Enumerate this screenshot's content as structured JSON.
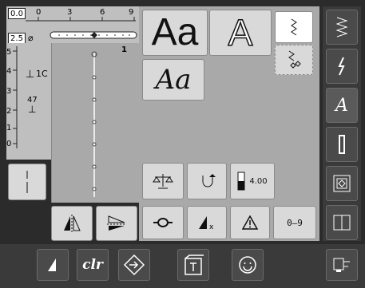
{
  "colors": {
    "background": "#2b2b2b",
    "lcd": "#bfbfbf",
    "panel": "#a9a9a9",
    "button": "#d9d9d9",
    "button_selected": "#ffffff",
    "dark_button": "#4a4a4a"
  },
  "top_ruler": {
    "value_box": "0.0",
    "ticks": [
      "0",
      "3",
      "6",
      "9"
    ]
  },
  "left_ruler": {
    "value_box": "2.5",
    "ticks": [
      "5",
      "4",
      "3",
      "2",
      "1",
      "0"
    ]
  },
  "stitch_info": {
    "presser_foot": "1C",
    "needle_label": "47"
  },
  "pattern": {
    "counter": "1"
  },
  "fonts": {
    "block_sample": "Aa",
    "outline_sample": "A",
    "script_sample": "Aa"
  },
  "mode_icons": {
    "zigzag": "zigzag-mode-icon",
    "motif": "motif-mode-icon"
  },
  "controls": {
    "stitch_length": "4.00",
    "sequence_label": "0–9"
  },
  "right_menu": {
    "items": [
      "practical-stitches-icon",
      "decorative-stitches-icon",
      "alphabets-icon",
      "buttonholes-icon",
      "quilt-stitches-icon",
      "attachments-icon"
    ],
    "alphabet_label": "A"
  },
  "bottom_bar": {
    "clr_label": "clr"
  }
}
